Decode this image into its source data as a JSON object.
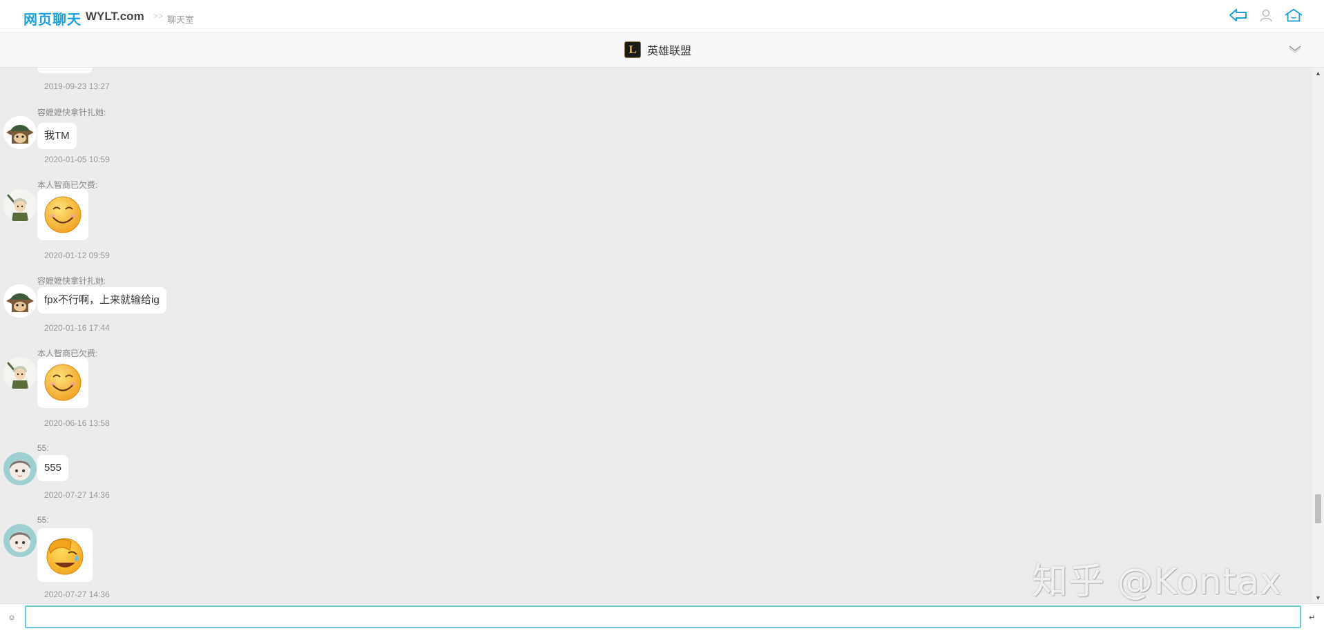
{
  "header": {
    "logo_cn": "网页聊天",
    "logo_en": "WYLT.com",
    "breadcrumb_sep": ">>",
    "breadcrumb": "聊天室",
    "icons": [
      "back-arrow-icon",
      "user-icon",
      "home-icon"
    ]
  },
  "room": {
    "logo_letter": "L",
    "name": "英雄联盟"
  },
  "messages": [
    {
      "timestamp": "2019-09-23 13:27"
    },
    {
      "user": "容嬷嬷快拿针扎她:",
      "avatar": "teemo-avatar",
      "text": "我TM",
      "timestamp": "2020-01-05 10:59"
    },
    {
      "user": "本人智商已欠费:",
      "avatar": "soldier-avatar",
      "emoji": "smile-emoji",
      "timestamp": "2020-01-12 09:59"
    },
    {
      "user": "容嬷嬷快拿针扎她:",
      "avatar": "teemo-avatar",
      "text": "fpx不行啊，上来就输给ig",
      "timestamp": "2020-01-16 17:44"
    },
    {
      "user": "本人智商已欠费:",
      "avatar": "soldier-avatar",
      "emoji": "smile-emoji",
      "timestamp": "2020-06-16 13:58"
    },
    {
      "user": "55:",
      "avatar": "girl-avatar",
      "text": "555",
      "timestamp": "2020-07-27 14:36"
    },
    {
      "user": "55:",
      "avatar": "girl-avatar",
      "emoji": "facepalm-emoji",
      "timestamp": "2020-07-27 14:36"
    }
  ],
  "input": {
    "value": "",
    "emoji_icon": "smiley-icon",
    "send_icon": "enter-icon"
  },
  "watermark": "知乎 @Kontax",
  "colors": {
    "brand": "#1ba0df",
    "background": "#ececec",
    "input_border": "#6fc6d6"
  }
}
